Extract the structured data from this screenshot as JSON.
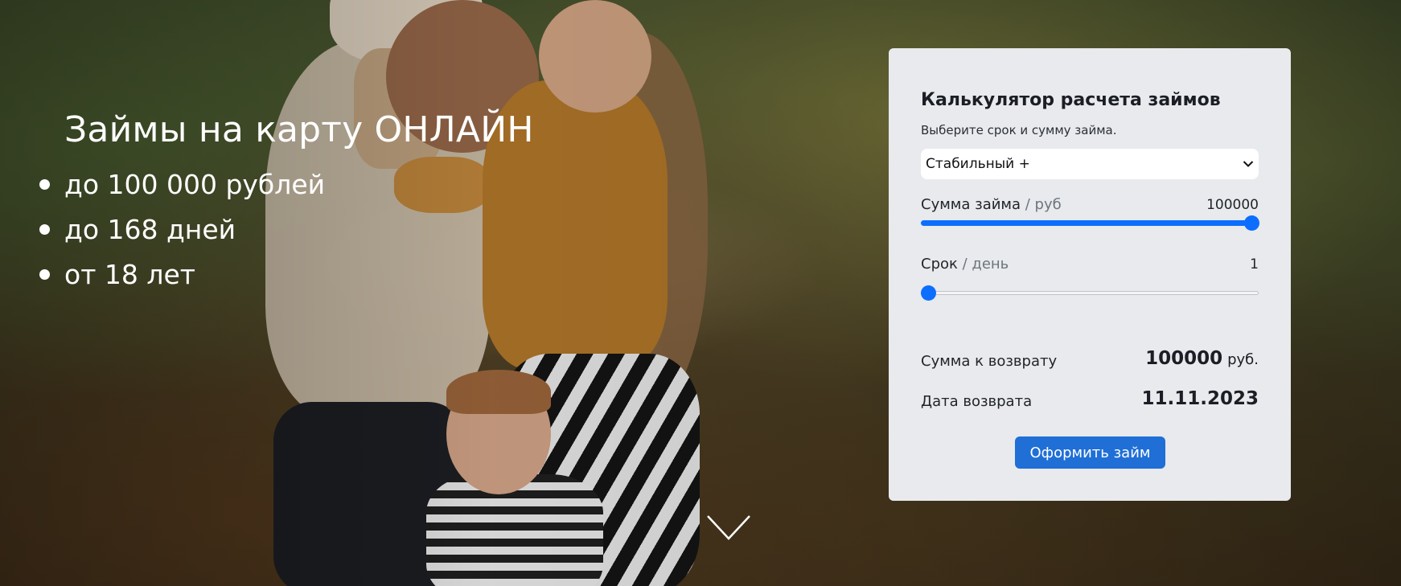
{
  "hero": {
    "title": "Займы на карту ОНЛАЙН",
    "features": [
      "до 100 000 рублей",
      "до 168 дней",
      "от 18 лет"
    ],
    "scroll_icon": "chevron-down-icon"
  },
  "calculator": {
    "title": "Калькулятор расчета займов",
    "subtitle": "Выберите срок и сумму займа.",
    "product_select": {
      "selected": "Стабильный +",
      "icon": "chevron-down-icon"
    },
    "amount": {
      "label": "Сумма займа",
      "unit": " / руб",
      "value": "100000",
      "fill_fraction": 1.0
    },
    "term": {
      "label": "Срок",
      "unit": " / день",
      "value": "1",
      "fill_fraction": 0.0
    },
    "repay_amount": {
      "label": "Сумма к возврату",
      "value": "100000",
      "currency": "руб."
    },
    "repay_date": {
      "label": "Дата возврата",
      "value": "11.11.2023"
    },
    "submit_label": "Оформить займ"
  },
  "colors": {
    "accent": "#0d6efd",
    "button": "#1f6fd6",
    "card_bg": "#e8eaee"
  }
}
